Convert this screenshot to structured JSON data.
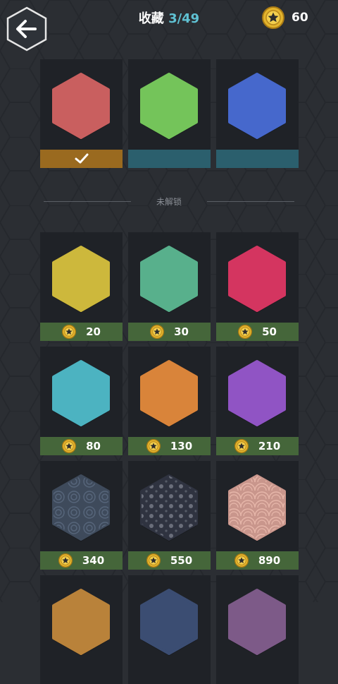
{
  "header": {
    "title": "收藏",
    "count": "3/49",
    "coins": "60",
    "back_icon": "arrow-left-icon",
    "coin_icon": "star-coin-icon"
  },
  "colors": {
    "owned_bar": "#9a6a1f",
    "unselected_bar": "#2b5f6d",
    "price_bar": "#45663a",
    "coin": "#d9a928"
  },
  "owned": [
    {
      "color": "#c95f5f",
      "selected": true,
      "icon": "checkmark-icon"
    },
    {
      "color": "#74c45a",
      "selected": false
    },
    {
      "color": "#4668cc",
      "selected": false
    }
  ],
  "divider_label": "未解锁",
  "locked": [
    {
      "color": "#cdb83c",
      "price": "20"
    },
    {
      "color": "#58b08c",
      "price": "30"
    },
    {
      "color": "#d43560",
      "price": "50"
    },
    {
      "color": "#4cb3c1",
      "price": "80"
    },
    {
      "color": "#d9843a",
      "price": "130"
    },
    {
      "color": "#9054c4",
      "price": "210"
    },
    {
      "color": "#3e4a5b",
      "price": "340",
      "pattern": "swirl"
    },
    {
      "color": "#2f3340",
      "price": "550",
      "pattern": "dots"
    },
    {
      "color": "#c9968c",
      "price": "890",
      "pattern": "waves"
    },
    {
      "color": "#b9823a",
      "price": "",
      "pattern": ""
    },
    {
      "color": "#3b4d72",
      "price": "",
      "pattern": ""
    },
    {
      "color": "#7d5a88",
      "price": "",
      "pattern": ""
    }
  ]
}
